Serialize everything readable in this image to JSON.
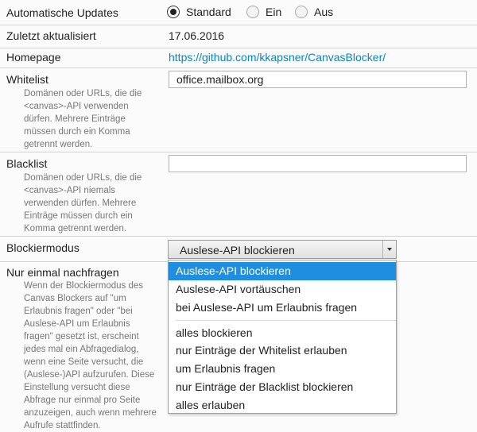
{
  "settings": {
    "updates": {
      "label": "Automatische Updates",
      "options": [
        "Standard",
        "Ein",
        "Aus"
      ],
      "selected": "Standard"
    },
    "last_updated": {
      "label": "Zuletzt aktualisiert",
      "value": "17.06.2016"
    },
    "homepage": {
      "label": "Homepage",
      "url": "https://github.com/kkapsner/CanvasBlocker/"
    },
    "whitelist": {
      "label": "Whitelist",
      "description": "Domänen oder URLs, die die <canvas>-API verwenden dürfen. Mehrere Einträge müssen durch ein Komma getrennt werden.",
      "value": "office.mailbox.org"
    },
    "blacklist": {
      "label": "Blacklist",
      "description": "Domänen oder URLs, die die <canvas>-API niemals verwenden dürfen. Mehrere Einträge müssen durch ein Komma getrennt werden.",
      "value": ""
    },
    "block_mode": {
      "label": "Blockiermodus",
      "selected": "Auslese-API blockieren",
      "options_group1": [
        "Auslese-API blockieren",
        "Auslese-API vortäuschen",
        "bei Auslese-API um Erlaubnis fragen"
      ],
      "options_group2": [
        "alles blockieren",
        "nur Einträge der Whitelist erlauben",
        "um Erlaubnis fragen",
        "nur Einträge der Blacklist blockieren",
        "alles erlauben"
      ]
    },
    "ask_once": {
      "label": "Nur einmal nachfragen",
      "description": "Wenn der Blockiermodus des Canvas Blockers auf \"um Erlaubnis fragen\" oder \"bei Auslese-API um Erlaubnis fragen\" gesetzt ist, erscheint jedes mal ein Abfragedialog, wenn eine Seite versucht, die (Auslese-)API aufzurufen. Diese Einstellung versucht diese Abfrage nur einmal pro Seite anzuzeigen, auch wenn mehrere Aufrufe stattfinden."
    }
  },
  "colors": {
    "accent": "#1e8fe0",
    "link": "#0a84c2",
    "description_text": "#777777",
    "row_border": "#d2d2d2"
  }
}
